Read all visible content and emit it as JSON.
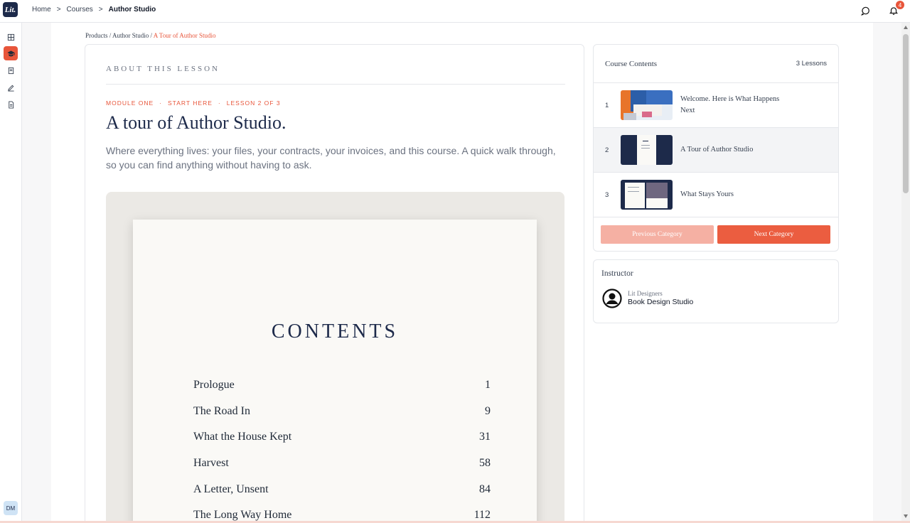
{
  "app": {
    "logo_text": "Lit."
  },
  "topbar": {
    "breadcrumb": [
      "Home",
      ">",
      "Courses",
      ">"
    ],
    "breadcrumb_current": "Author Studio",
    "notification_count": "4"
  },
  "rail": {
    "user_initials": "DM"
  },
  "page_breadcrumb": {
    "path": "Products / Author Studio / ",
    "current": "A Tour of Author Studio"
  },
  "lesson": {
    "section_label": "ABOUT THIS LESSON",
    "module": "MODULE ONE",
    "sep": "·",
    "start": "START HERE",
    "position": "LESSON 2 OF 3",
    "title": "A tour of Author Studio.",
    "description": "Where everything lives: your files, your contracts, your invoices, and this course. A quick walk through, so you can find anything without having to ask."
  },
  "preview": {
    "heading": "CONTENTS",
    "toc": [
      {
        "title": "Prologue",
        "page": "1"
      },
      {
        "title": "The Road In",
        "page": "9"
      },
      {
        "title": "What the House Kept",
        "page": "31"
      },
      {
        "title": "Harvest",
        "page": "58"
      },
      {
        "title": "A Letter, Unsent",
        "page": "84"
      },
      {
        "title": "The Long Way Home",
        "page": "112"
      }
    ]
  },
  "course_contents": {
    "title": "Course Contents",
    "count": "3 Lessons",
    "lessons": [
      {
        "num": "1",
        "label": "Welcome. Here is What Happens Next"
      },
      {
        "num": "2",
        "label": "A Tour of Author Studio"
      },
      {
        "num": "3",
        "label": "What Stays Yours"
      }
    ],
    "prev_label": "Previous Category",
    "next_label": "Next Category"
  },
  "instructor": {
    "title": "Instructor",
    "org": "Lit Designers",
    "name": "Book Design Studio"
  },
  "colors": {
    "accent": "#e8553a",
    "navy": "#1d2a4a"
  }
}
